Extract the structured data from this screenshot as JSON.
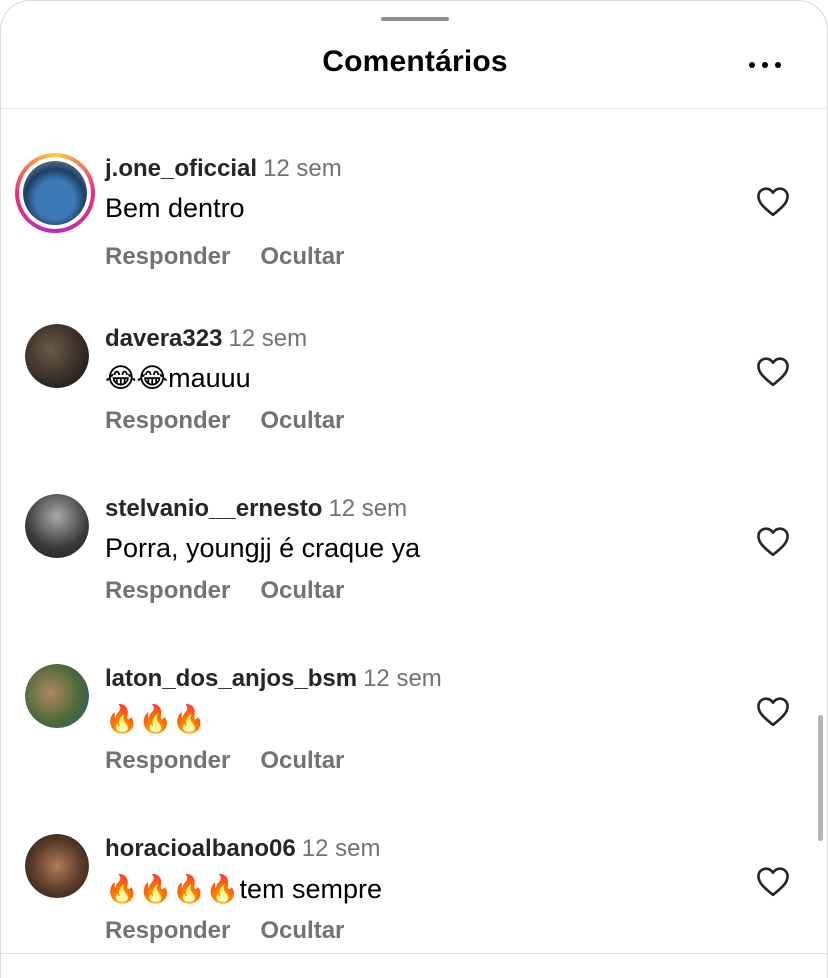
{
  "sheet": {
    "title": "Comentários",
    "more_icon": "more-horizontal-icon"
  },
  "comments": [
    {
      "username": "j.one_oficcial",
      "time": "12 sem",
      "text": "Bem dentro",
      "reply_label": "Responder",
      "hide_label": "Ocultar",
      "has_story_ring": true
    },
    {
      "username": "davera323",
      "time": "12 sem",
      "text": "😂😂mauuu",
      "reply_label": "Responder",
      "hide_label": "Ocultar",
      "has_story_ring": false
    },
    {
      "username": "stelvanio__ernesto",
      "time": "12 sem",
      "text": "Porra, youngjj é craque ya",
      "reply_label": "Responder",
      "hide_label": "Ocultar",
      "has_story_ring": false
    },
    {
      "username": "laton_dos_anjos_bsm",
      "time": "12 sem",
      "text": "🔥🔥🔥",
      "reply_label": "Responder",
      "hide_label": "Ocultar",
      "has_story_ring": false
    },
    {
      "username": "horacioalbano06",
      "time": "12 sem",
      "text": "🔥🔥🔥🔥tem sempre",
      "reply_label": "Responder",
      "hide_label": "Ocultar",
      "has_story_ring": false
    }
  ],
  "icons": {
    "like": "heart-outline-icon"
  }
}
